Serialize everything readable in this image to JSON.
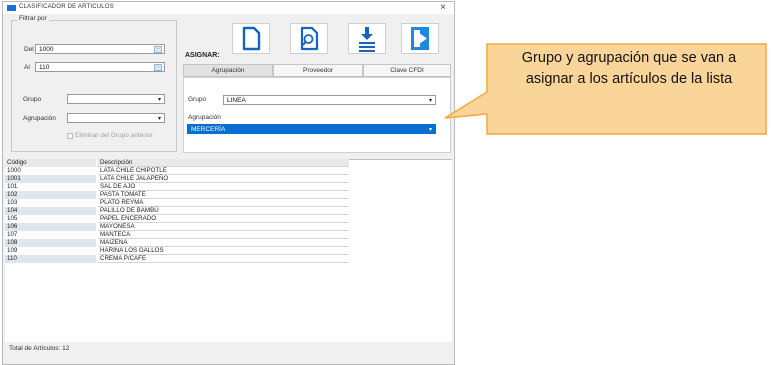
{
  "window": {
    "title": "CLASIFICADOR DE ARTICULOS",
    "close_glyph": "×"
  },
  "filter": {
    "legend": "Filtrar por",
    "del_label": "Del",
    "del_value": "1000",
    "al_label": "Al",
    "al_value": "110",
    "grupo_label": "Grupo",
    "grupo_value": "",
    "agrupacion_label": "Agrupación",
    "agrupacion_value": "",
    "checkbox_label": "Eliminar del Grupo anterior",
    "checkbox_checked": false
  },
  "toolbar": {
    "asignar_label": "ASIGNAR:",
    "icons": [
      "new-document-icon",
      "search-document-icon",
      "download-icon",
      "exit-icon"
    ]
  },
  "tabs": [
    {
      "label": "Agrupación",
      "selected": true
    },
    {
      "label": "Proveedor",
      "selected": false
    },
    {
      "label": "Clave CFDI",
      "selected": false
    }
  ],
  "assign": {
    "grupo_label": "Grupo",
    "grupo_value": "LINEA",
    "agrupacion_label": "Agrupación",
    "agrupacion_value": "MERCERÍA"
  },
  "table": {
    "headers": [
      "Código",
      "Descripción"
    ],
    "rows": [
      [
        "1000",
        "LATA CHILE CHIPOTLE"
      ],
      [
        "1001",
        "LATA CHILE JALAPEÑO"
      ],
      [
        "101",
        "SAL DE AJO"
      ],
      [
        "102",
        "PASTA TOMATE"
      ],
      [
        "103",
        "PLATO REYMA"
      ],
      [
        "104",
        "PALILLO DE BAMBÚ"
      ],
      [
        "105",
        "PAPEL ENCERADO"
      ],
      [
        "106",
        "MAYONESA"
      ],
      [
        "107",
        "MANTECA"
      ],
      [
        "108",
        "MAIZENA"
      ],
      [
        "109",
        "HARINA LOS GALLOS"
      ],
      [
        "110",
        "CREMA P/CAFE"
      ]
    ]
  },
  "footer": {
    "total_label": "Total de Artículos:",
    "total_value": "12"
  },
  "callout": {
    "text": "Grupo y agrupación que se van a asignar a los artículos de la lista"
  },
  "colors": {
    "accent": "#1e6fd9",
    "callout_fill": "#fad59a",
    "callout_border": "#f2a93b",
    "selected_fill": "#0a6ed1",
    "row_shade": "#dfe7ee"
  }
}
